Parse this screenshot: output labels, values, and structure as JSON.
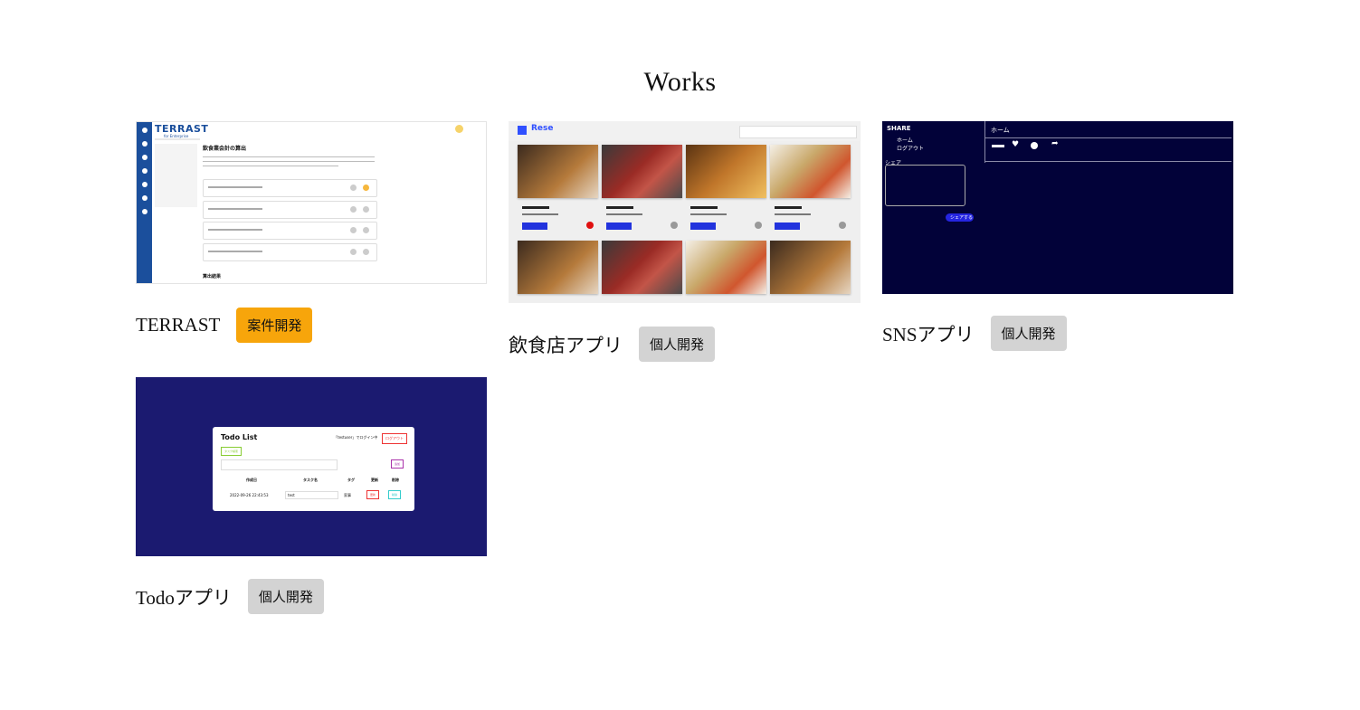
{
  "page": {
    "title": "Works"
  },
  "works": [
    {
      "name": "TERRAST",
      "badge": "案件開発",
      "badge_color": "#f7a50b",
      "thumb": {
        "logo": "TERRAST",
        "logo_sub": "for Enterprise",
        "heading": "飲食業会計の算出",
        "questions": [
          "土地の利用はありますか？",
          "主業者との利用はありますか？",
          "地下水の利用はありますか？",
          "その他水の利用はありますか？"
        ],
        "result_heading": "算出結果"
      }
    },
    {
      "name": "飲食店アプリ",
      "badge": "個人開発",
      "badge_color": "#d3d3d3",
      "thumb": {
        "logo": "Rese",
        "search_filters": [
          "All area",
          "All genre",
          "Search ..."
        ],
        "shops": [
          "仙人",
          "牛助",
          "戦慄",
          "ルーク"
        ],
        "detail_label": "詳しくみる"
      }
    },
    {
      "name": "SNSアプリ",
      "badge": "個人開発",
      "badge_color": "#d3d3d3",
      "thumb": {
        "logo": "SHARE",
        "nav": [
          "ホーム",
          "ログアウト"
        ],
        "share_label": "シェア",
        "share_button": "シェアする",
        "header": "ホーム"
      }
    },
    {
      "name": "Todoアプリ",
      "badge": "個人開発",
      "badge_color": "#d3d3d3",
      "thumb": {
        "title": "Todo List",
        "login_text": "「testuser」でログイン中",
        "logout_button": "ログアウト",
        "columns": [
          "作成日",
          "タスク名",
          "タグ",
          "更新",
          "削除"
        ],
        "row": {
          "date": "2022-09-26 22:43:53",
          "task": "test",
          "tag": "家事",
          "update": "更新",
          "delete": "削除"
        },
        "add_button": "追加",
        "search_button": "タスク検索"
      }
    }
  ],
  "colors": {
    "terrast_blue": "#1b4f9c",
    "rese_blue": "#3050ff",
    "sns_bg": "#020239",
    "todo_bg": "#1b1a70"
  }
}
